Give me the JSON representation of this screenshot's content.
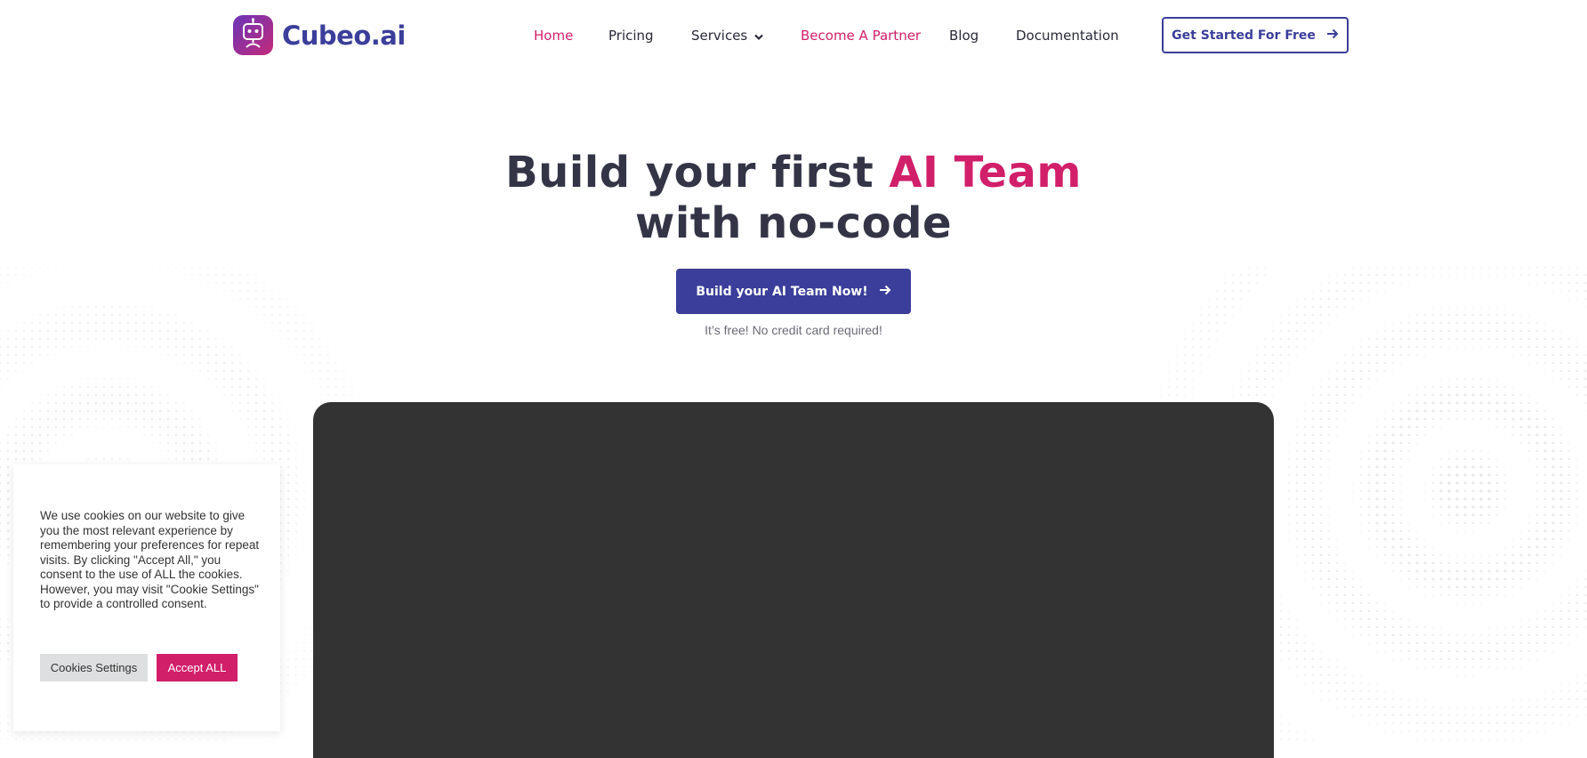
{
  "brand": {
    "name": "Cubeo.ai",
    "primary_color": "#3b3e9a",
    "accent_color": "#d11f6a",
    "logo_icon": "robot-icon"
  },
  "nav": {
    "items": [
      {
        "label": "Home",
        "state": "active"
      },
      {
        "label": "Pricing"
      },
      {
        "label": "Services",
        "has_dropdown": true
      },
      {
        "label": "Become A Partner",
        "state": "accent"
      },
      {
        "label": "Blog"
      },
      {
        "label": "Documentation"
      }
    ],
    "cta_label": "Get Started For Free"
  },
  "hero": {
    "title_part1": "Build your first ",
    "title_highlight": "AI Team",
    "title_line2": "with no-code",
    "cta_label": "Build your AI Team Now!",
    "note": "It’s free! No credit card required!"
  },
  "video": {
    "background_color": "#333333"
  },
  "cookie_banner": {
    "message": "We use cookies on our website to give you the most relevant experience by remembering your preferences for repeat visits. By clicking \"Accept All,\" you consent to the use of ALL the cookies. However, you may visit \"Cookie Settings\" to provide a controlled consent.",
    "settings_label": "Cookies Settings",
    "accept_label": "Accept ALL"
  }
}
